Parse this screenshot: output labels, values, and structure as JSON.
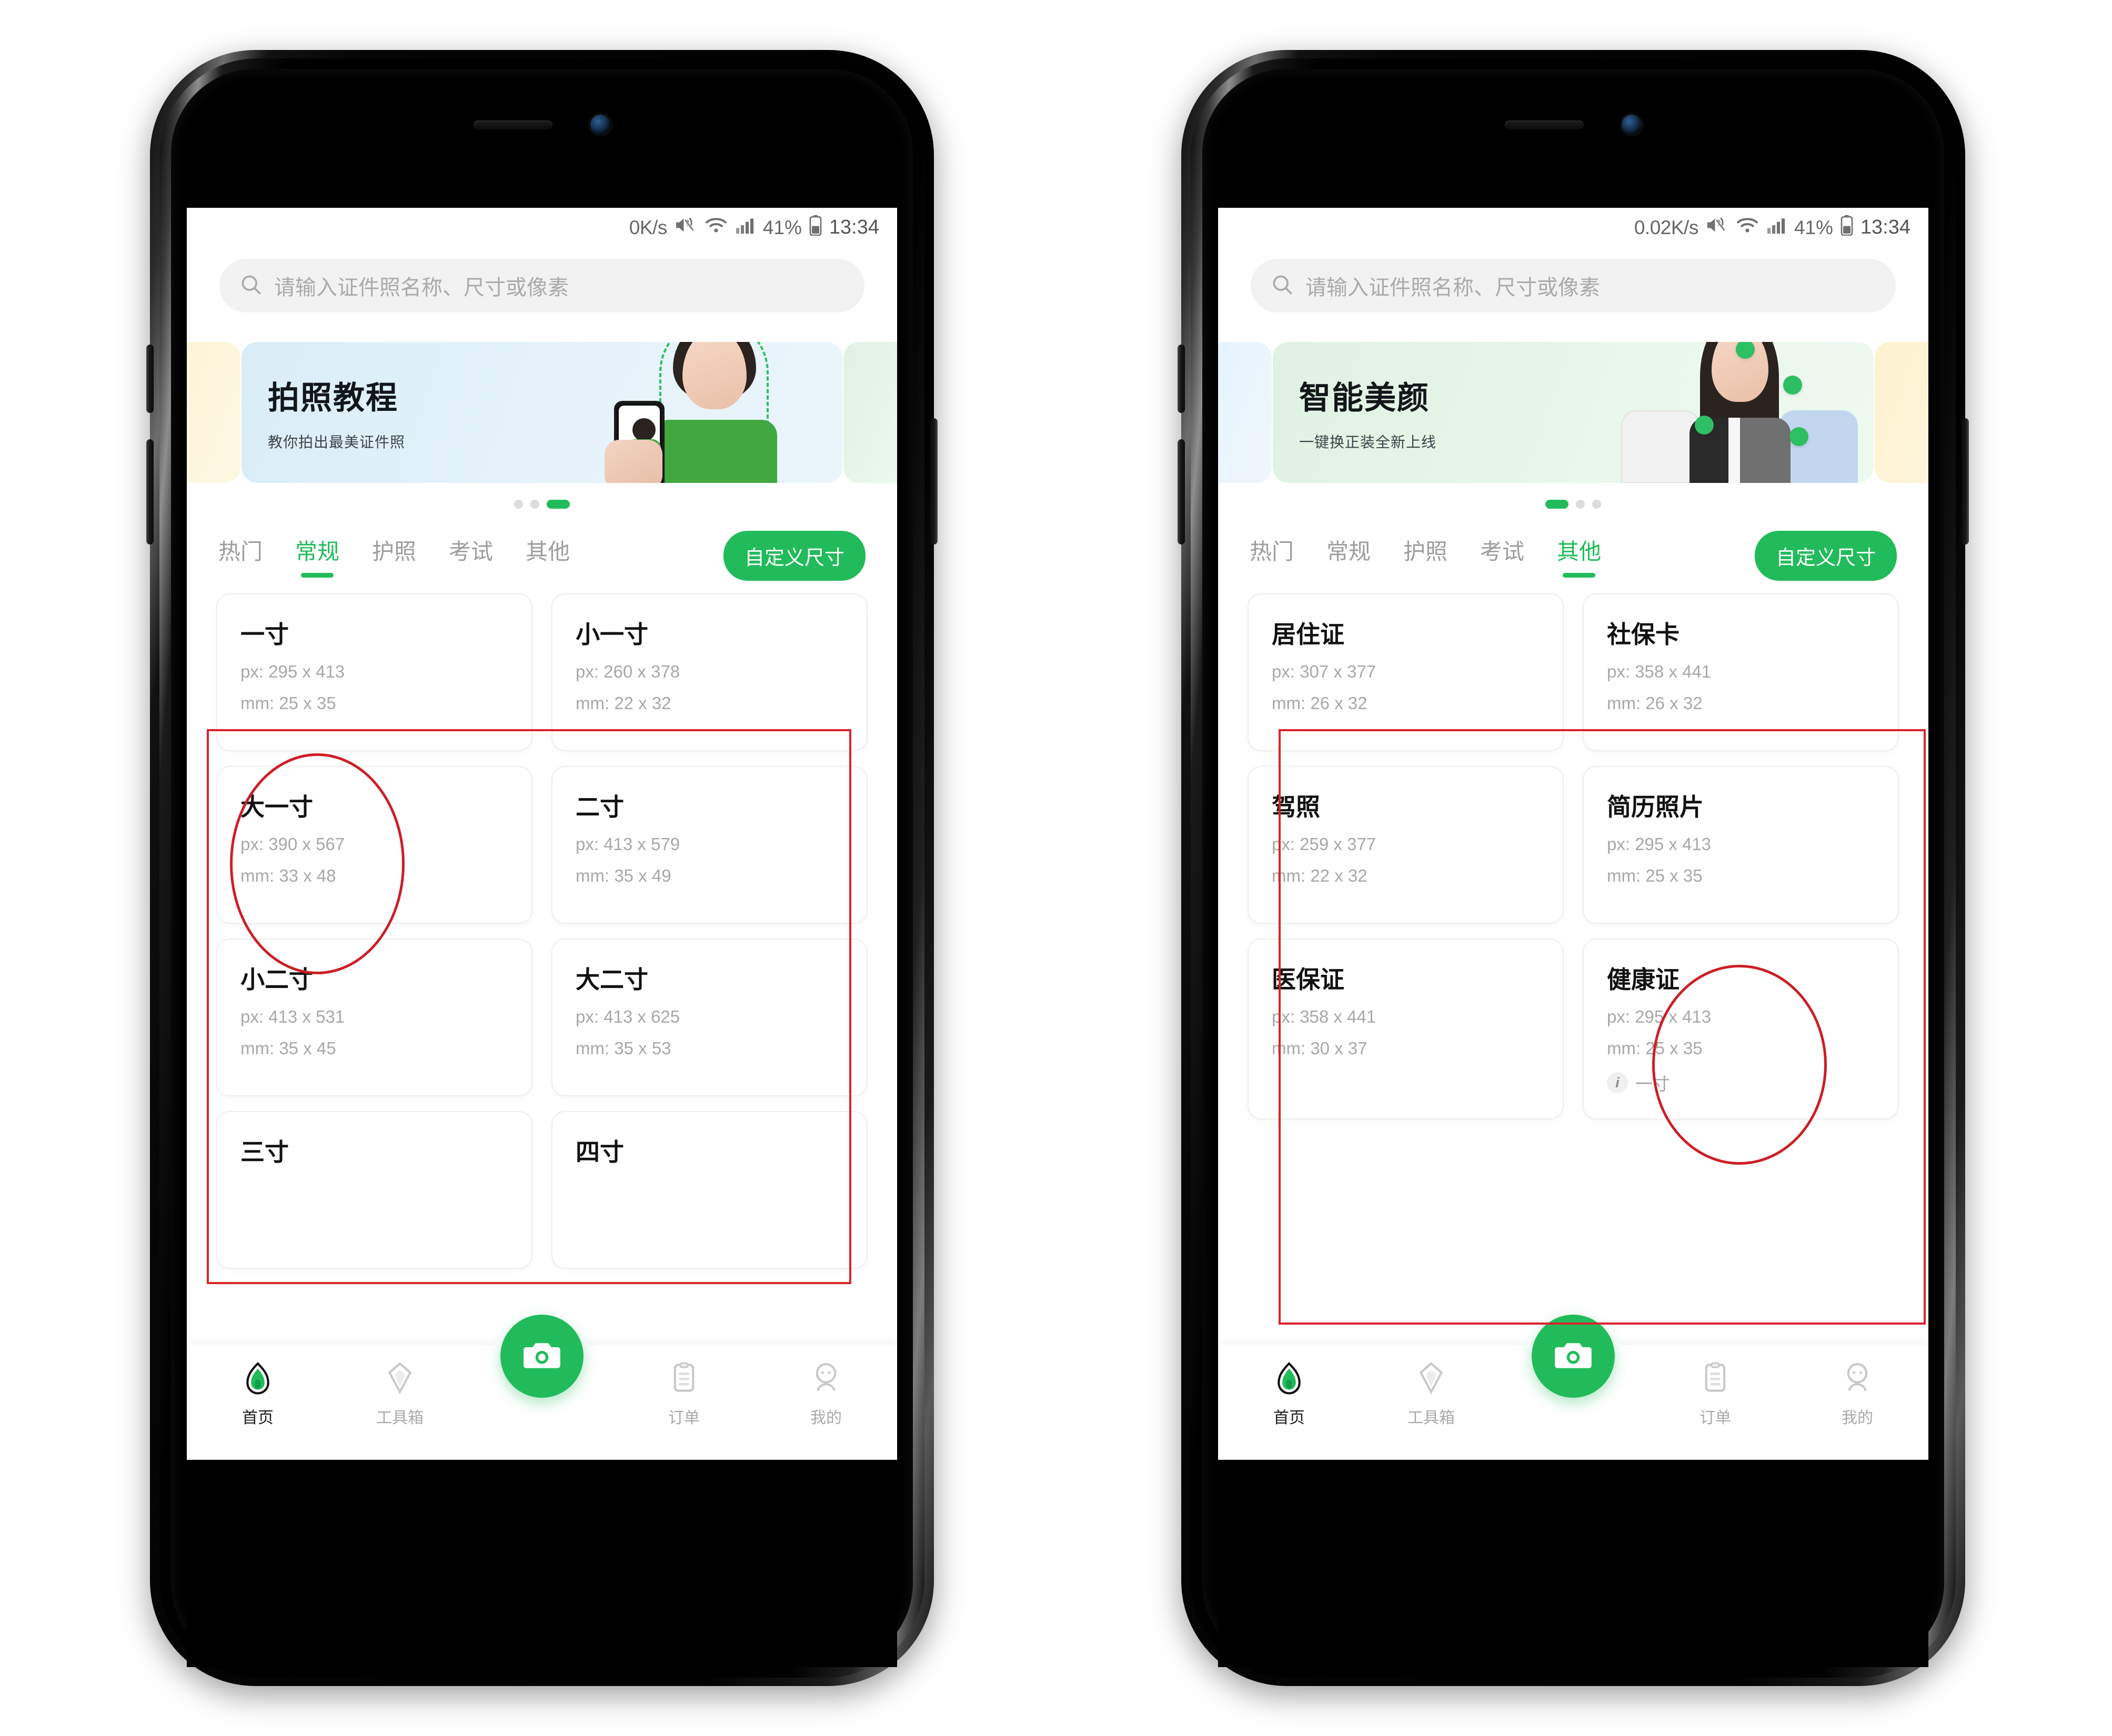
{
  "phones": [
    {
      "id": "phone-left",
      "status": {
        "netspeed": "0K/s",
        "battery": "41%",
        "time": "13:34",
        "mute_icon": "mute-icon",
        "wifi_icon": "wifi-icon",
        "signal_icon": "signal-icon",
        "battery_icon": "battery-icon"
      },
      "search": {
        "placeholder": "请输入证件照名称、尺寸或像素",
        "icon": "search-icon"
      },
      "banner": {
        "title": "拍照教程",
        "subtitle": "教你拍出最美证件照",
        "theme": "#d9edf7"
      },
      "dots": {
        "count": 3,
        "active": 2
      },
      "tabs": [
        {
          "label": "热门",
          "active": false
        },
        {
          "label": "常规",
          "active": true
        },
        {
          "label": "护照",
          "active": false
        },
        {
          "label": "考试",
          "active": false
        },
        {
          "label": "其他",
          "active": false
        }
      ],
      "custom_size_button": "自定义尺寸",
      "cards": [
        {
          "name": "一寸",
          "px": "px: 295 x 413",
          "mm": "mm: 25 x 35",
          "tag": ""
        },
        {
          "name": "小一寸",
          "px": "px: 260 x 378",
          "mm": "mm: 22 x 32",
          "tag": ""
        },
        {
          "name": "大一寸",
          "px": "px: 390 x 567",
          "mm": "mm: 33 x 48",
          "tag": ""
        },
        {
          "name": "二寸",
          "px": "px: 413 x 579",
          "mm": "mm: 35 x 49",
          "tag": ""
        },
        {
          "name": "小二寸",
          "px": "px: 413 x 531",
          "mm": "mm: 35 x 45",
          "tag": ""
        },
        {
          "name": "大二寸",
          "px": "px: 413 x 625",
          "mm": "mm: 35 x 53",
          "tag": ""
        },
        {
          "name": "三寸",
          "px": "",
          "mm": "",
          "tag": ""
        },
        {
          "name": "四寸",
          "px": "",
          "mm": "",
          "tag": ""
        }
      ],
      "tabbar": [
        {
          "label": "首页",
          "icon": "home-icon",
          "active": true
        },
        {
          "label": "工具箱",
          "icon": "toolbox-icon",
          "active": false
        },
        {
          "label": "订单",
          "icon": "orders-icon",
          "active": false
        },
        {
          "label": "我的",
          "icon": "profile-icon",
          "active": false
        }
      ],
      "camera_button_icon": "camera-icon"
    },
    {
      "id": "phone-right",
      "status": {
        "netspeed": "0.02K/s",
        "battery": "41%",
        "time": "13:34",
        "mute_icon": "mute-icon",
        "wifi_icon": "wifi-icon",
        "signal_icon": "signal-icon",
        "battery_icon": "battery-icon"
      },
      "search": {
        "placeholder": "请输入证件照名称、尺寸或像素",
        "icon": "search-icon"
      },
      "banner": {
        "title": "智能美颜",
        "subtitle": "一键换正装全新上线",
        "theme": "#dff2e3"
      },
      "dots": {
        "count": 3,
        "active": 0
      },
      "tabs": [
        {
          "label": "热门",
          "active": false
        },
        {
          "label": "常规",
          "active": false
        },
        {
          "label": "护照",
          "active": false
        },
        {
          "label": "考试",
          "active": false
        },
        {
          "label": "其他",
          "active": true
        }
      ],
      "custom_size_button": "自定义尺寸",
      "cards": [
        {
          "name": "居住证",
          "px": "px: 307 x 377",
          "mm": "mm: 26 x 32",
          "tag": ""
        },
        {
          "name": "社保卡",
          "px": "px: 358 x 441",
          "mm": "mm: 26 x 32",
          "tag": ""
        },
        {
          "name": "驾照",
          "px": "px: 259 x 377",
          "mm": "mm: 22 x 32",
          "tag": ""
        },
        {
          "name": "简历照片",
          "px": "px: 295 x 413",
          "mm": "mm: 25 x 35",
          "tag": ""
        },
        {
          "name": "医保证",
          "px": "px: 358 x 441",
          "mm": "mm: 30 x 37",
          "tag": ""
        },
        {
          "name": "健康证",
          "px": "px: 295 x 413",
          "mm": "mm: 25 x 35",
          "tag": "一寸"
        }
      ],
      "tabbar": [
        {
          "label": "首页",
          "icon": "home-icon",
          "active": true
        },
        {
          "label": "工具箱",
          "icon": "toolbox-icon",
          "active": false
        },
        {
          "label": "订单",
          "icon": "orders-icon",
          "active": false
        },
        {
          "label": "我的",
          "icon": "profile-icon",
          "active": false
        }
      ],
      "camera_button_icon": "camera-icon"
    }
  ],
  "annotations": {
    "accent_color": "#d9232d",
    "left_box_label": "card-grid-highlight",
    "left_ellipse_label": "highlight-yi-cun",
    "right_box_label": "card-grid-highlight",
    "right_ellipse_label": "highlight-jianli-zhaopian"
  }
}
